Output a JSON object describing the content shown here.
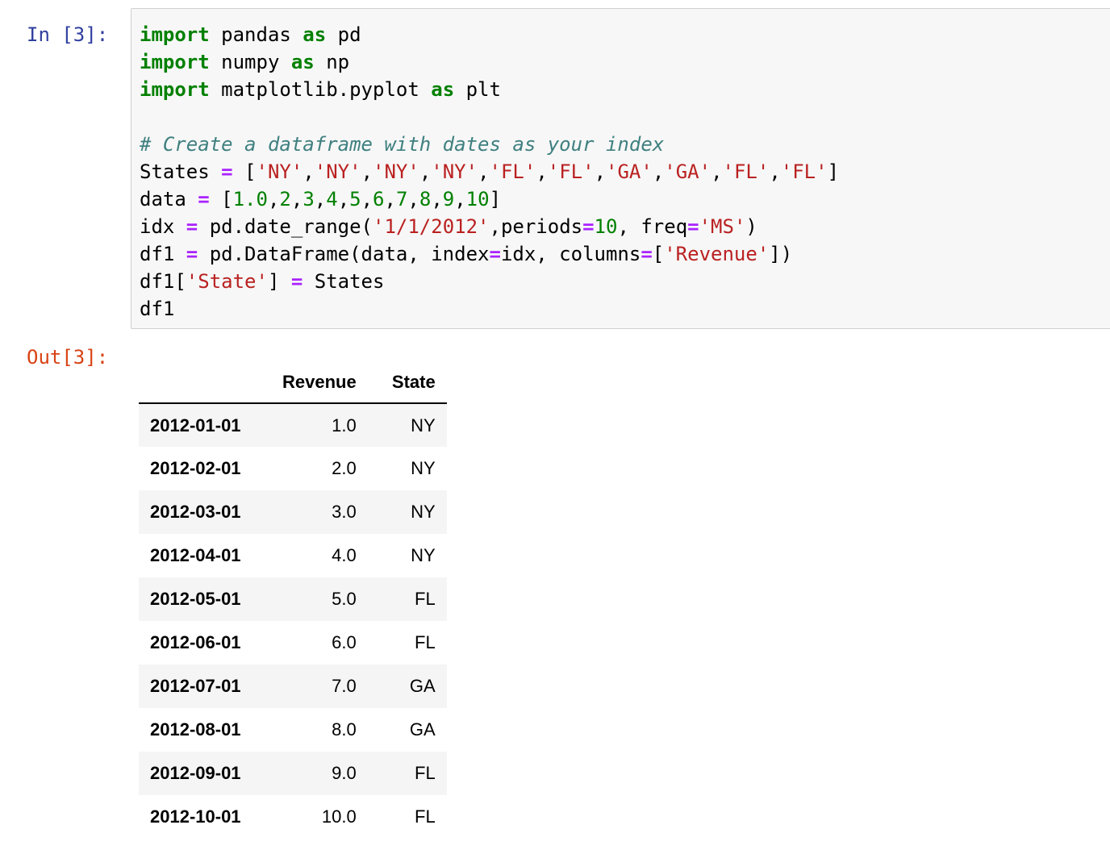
{
  "cell_in": {
    "prompt": "In [3]:",
    "code_lines": [
      [
        {
          "t": "import",
          "c": "kw"
        },
        {
          "t": " pandas ",
          "c": ""
        },
        {
          "t": "as",
          "c": "kw"
        },
        {
          "t": " pd",
          "c": ""
        }
      ],
      [
        {
          "t": "import",
          "c": "kw"
        },
        {
          "t": " numpy ",
          "c": ""
        },
        {
          "t": "as",
          "c": "kw"
        },
        {
          "t": " np",
          "c": ""
        }
      ],
      [
        {
          "t": "import",
          "c": "kw"
        },
        {
          "t": " matplotlib.pyplot ",
          "c": ""
        },
        {
          "t": "as",
          "c": "kw"
        },
        {
          "t": " plt",
          "c": ""
        }
      ],
      [],
      [
        {
          "t": "# Create a dataframe with dates as your index",
          "c": "cm"
        }
      ],
      [
        {
          "t": "States ",
          "c": ""
        },
        {
          "t": "=",
          "c": "op"
        },
        {
          "t": " [",
          "c": ""
        },
        {
          "t": "'NY'",
          "c": "str"
        },
        {
          "t": ",",
          "c": ""
        },
        {
          "t": "'NY'",
          "c": "str"
        },
        {
          "t": ",",
          "c": ""
        },
        {
          "t": "'NY'",
          "c": "str"
        },
        {
          "t": ",",
          "c": ""
        },
        {
          "t": "'NY'",
          "c": "str"
        },
        {
          "t": ",",
          "c": ""
        },
        {
          "t": "'FL'",
          "c": "str"
        },
        {
          "t": ",",
          "c": ""
        },
        {
          "t": "'FL'",
          "c": "str"
        },
        {
          "t": ",",
          "c": ""
        },
        {
          "t": "'GA'",
          "c": "str"
        },
        {
          "t": ",",
          "c": ""
        },
        {
          "t": "'GA'",
          "c": "str"
        },
        {
          "t": ",",
          "c": ""
        },
        {
          "t": "'FL'",
          "c": "str"
        },
        {
          "t": ",",
          "c": ""
        },
        {
          "t": "'FL'",
          "c": "str"
        },
        {
          "t": "]",
          "c": ""
        }
      ],
      [
        {
          "t": "data ",
          "c": ""
        },
        {
          "t": "=",
          "c": "op"
        },
        {
          "t": " [",
          "c": ""
        },
        {
          "t": "1.0",
          "c": "num"
        },
        {
          "t": ",",
          "c": ""
        },
        {
          "t": "2",
          "c": "num"
        },
        {
          "t": ",",
          "c": ""
        },
        {
          "t": "3",
          "c": "num"
        },
        {
          "t": ",",
          "c": ""
        },
        {
          "t": "4",
          "c": "num"
        },
        {
          "t": ",",
          "c": ""
        },
        {
          "t": "5",
          "c": "num"
        },
        {
          "t": ",",
          "c": ""
        },
        {
          "t": "6",
          "c": "num"
        },
        {
          "t": ",",
          "c": ""
        },
        {
          "t": "7",
          "c": "num"
        },
        {
          "t": ",",
          "c": ""
        },
        {
          "t": "8",
          "c": "num"
        },
        {
          "t": ",",
          "c": ""
        },
        {
          "t": "9",
          "c": "num"
        },
        {
          "t": ",",
          "c": ""
        },
        {
          "t": "10",
          "c": "num"
        },
        {
          "t": "]",
          "c": ""
        }
      ],
      [
        {
          "t": "idx ",
          "c": ""
        },
        {
          "t": "=",
          "c": "op"
        },
        {
          "t": " pd.date_range(",
          "c": ""
        },
        {
          "t": "'1/1/2012'",
          "c": "str"
        },
        {
          "t": ",periods",
          "c": ""
        },
        {
          "t": "=",
          "c": "op"
        },
        {
          "t": "10",
          "c": "num"
        },
        {
          "t": ", freq",
          "c": ""
        },
        {
          "t": "=",
          "c": "op"
        },
        {
          "t": "'MS'",
          "c": "str"
        },
        {
          "t": ")",
          "c": ""
        }
      ],
      [
        {
          "t": "df1 ",
          "c": ""
        },
        {
          "t": "=",
          "c": "op"
        },
        {
          "t": " pd.DataFrame(data, index",
          "c": ""
        },
        {
          "t": "=",
          "c": "op"
        },
        {
          "t": "idx, columns",
          "c": ""
        },
        {
          "t": "=",
          "c": "op"
        },
        {
          "t": "[",
          "c": ""
        },
        {
          "t": "'Revenue'",
          "c": "str"
        },
        {
          "t": "])",
          "c": ""
        }
      ],
      [
        {
          "t": "df1[",
          "c": ""
        },
        {
          "t": "'State'",
          "c": "str"
        },
        {
          "t": "] ",
          "c": ""
        },
        {
          "t": "=",
          "c": "op"
        },
        {
          "t": " States",
          "c": ""
        }
      ],
      [
        {
          "t": "df1",
          "c": ""
        }
      ]
    ]
  },
  "cell_out": {
    "prompt": "Out[3]:",
    "table": {
      "index_header": "",
      "columns": [
        "Revenue",
        "State"
      ],
      "rows": [
        {
          "index": "2012-01-01",
          "values": [
            "1.0",
            "NY"
          ]
        },
        {
          "index": "2012-02-01",
          "values": [
            "2.0",
            "NY"
          ]
        },
        {
          "index": "2012-03-01",
          "values": [
            "3.0",
            "NY"
          ]
        },
        {
          "index": "2012-04-01",
          "values": [
            "4.0",
            "NY"
          ]
        },
        {
          "index": "2012-05-01",
          "values": [
            "5.0",
            "FL"
          ]
        },
        {
          "index": "2012-06-01",
          "values": [
            "6.0",
            "FL"
          ]
        },
        {
          "index": "2012-07-01",
          "values": [
            "7.0",
            "GA"
          ]
        },
        {
          "index": "2012-08-01",
          "values": [
            "8.0",
            "GA"
          ]
        },
        {
          "index": "2012-09-01",
          "values": [
            "9.0",
            "FL"
          ]
        },
        {
          "index": "2012-10-01",
          "values": [
            "10.0",
            "FL"
          ]
        }
      ]
    }
  },
  "colors": {
    "keyword": "#008000",
    "string": "#ba2121",
    "number": "#008000",
    "operator": "#aa22ff",
    "comment": "#408080",
    "prompt_in": "#303f9f",
    "prompt_out": "#d84315",
    "code_background": "#f7f7f7"
  }
}
